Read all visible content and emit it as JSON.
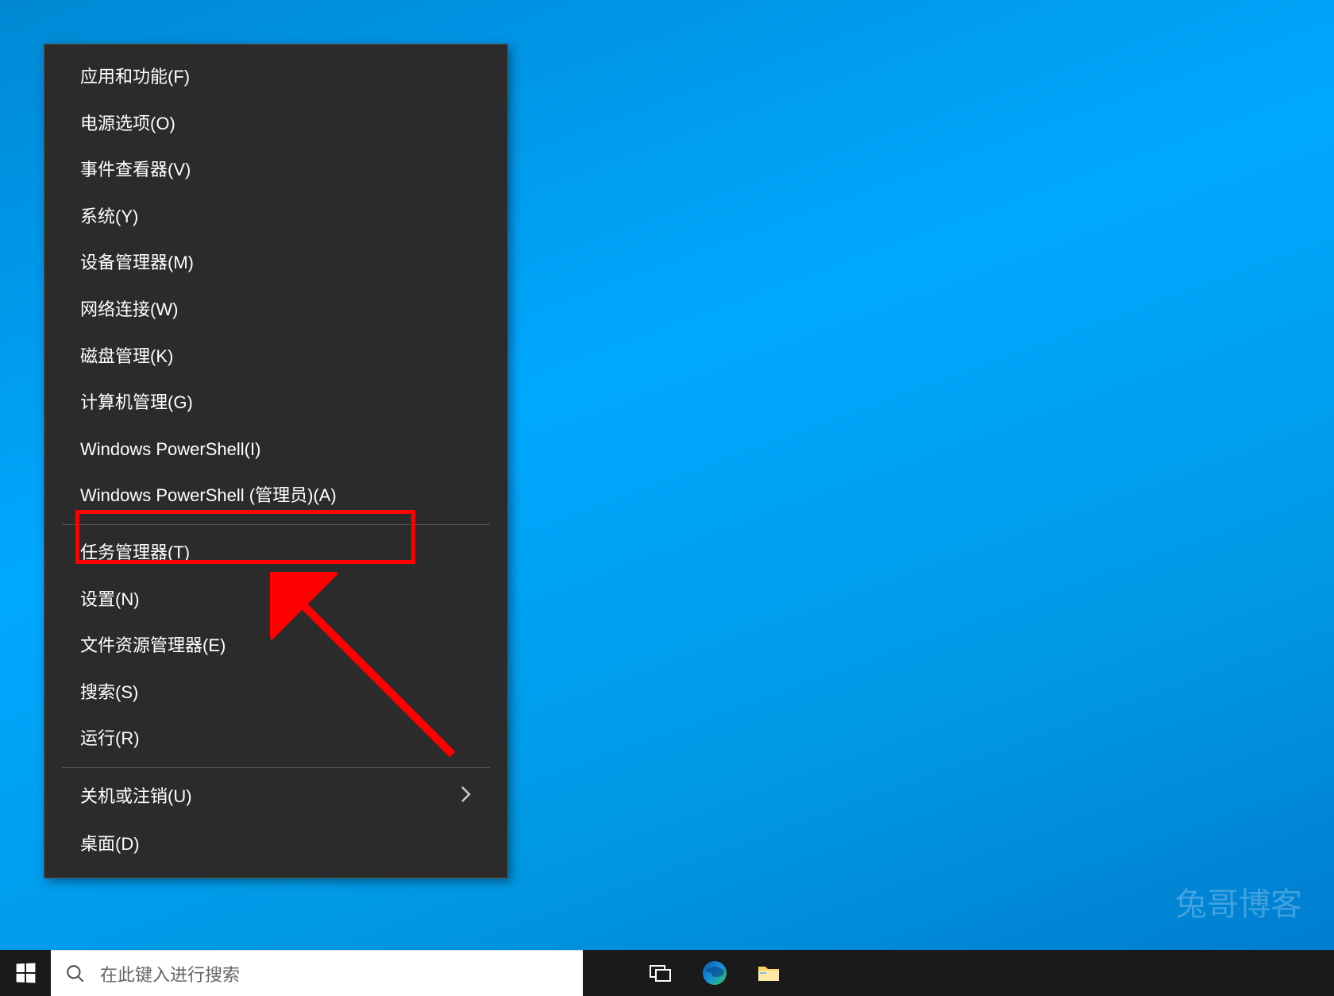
{
  "menu": {
    "items_group1": [
      {
        "label": "应用和功能(F)"
      },
      {
        "label": "电源选项(O)"
      },
      {
        "label": "事件查看器(V)"
      },
      {
        "label": "系统(Y)"
      },
      {
        "label": "设备管理器(M)"
      },
      {
        "label": "网络连接(W)"
      },
      {
        "label": "磁盘管理(K)"
      },
      {
        "label": "计算机管理(G)"
      },
      {
        "label": "Windows PowerShell(I)"
      },
      {
        "label": "Windows PowerShell (管理员)(A)"
      }
    ],
    "items_group2": [
      {
        "label": "任务管理器(T)"
      },
      {
        "label": "设置(N)"
      },
      {
        "label": "文件资源管理器(E)"
      },
      {
        "label": "搜索(S)"
      },
      {
        "label": "运行(R)"
      }
    ],
    "items_group3": [
      {
        "label": "关机或注销(U)",
        "submenu": true
      },
      {
        "label": "桌面(D)"
      }
    ]
  },
  "taskbar": {
    "search_placeholder": "在此键入进行搜索"
  },
  "watermark": "兔哥博客"
}
